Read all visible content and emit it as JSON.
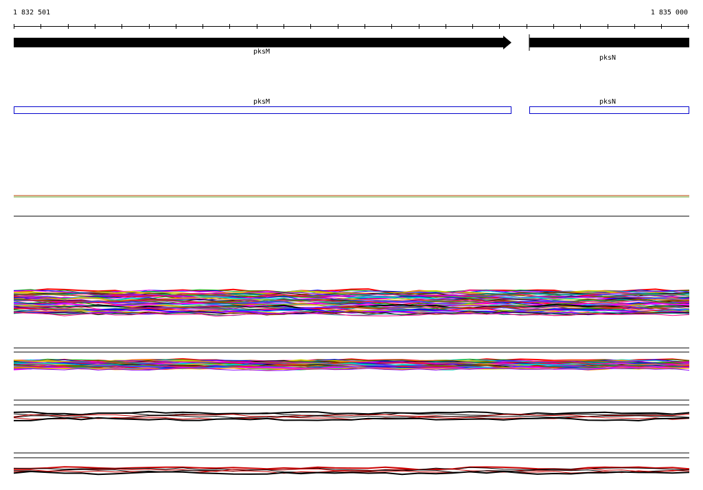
{
  "ruler": {
    "start": "1 832 501",
    "end": "1 835 000"
  },
  "genes": [
    {
      "name": "pksM",
      "strand": "+"
    },
    {
      "name": "pksN",
      "strand": "+"
    }
  ],
  "features": [
    {
      "name": "pksM"
    },
    {
      "name": "pksN"
    }
  ],
  "colors": {
    "gene_arrow": "#000000",
    "feature_box": "#0000cc",
    "track_line_a": "#b84000",
    "track_line_b": "#66aa33"
  }
}
